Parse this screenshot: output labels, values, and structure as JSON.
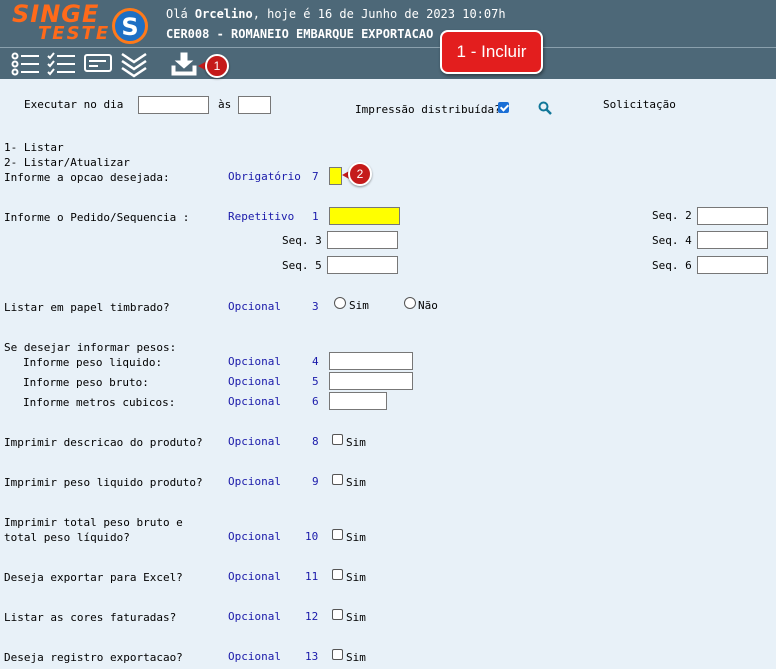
{
  "header": {
    "logo_line1": "SINGE",
    "logo_line2": "TESTE",
    "logo_mark": "S",
    "greeting_pre": "Olá ",
    "user": "Orcelino",
    "greeting_post": ", hoje é 16 de Junho de 2023 10:07h",
    "title": "CER008 - ROMANEIO EMBARQUE EXPORTACAO"
  },
  "toolbar": {
    "icons": [
      "list-icon",
      "checklist-icon",
      "card-icon",
      "chevrons-down-icon",
      "download-tray-icon"
    ]
  },
  "annotations": {
    "callout": "1 - Incluir",
    "badge1": "1",
    "badge2": "2"
  },
  "top": {
    "exec_label": "Executar no dia",
    "as_label": "às",
    "dist_label": "Impressão distribuída?",
    "dist_checked": true,
    "solic_label": "Solicitação"
  },
  "options": {
    "opt1": "1- Listar",
    "opt2": "2- Listar/Atualizar"
  },
  "fields": {
    "opcao": {
      "label": "Informe a opcao desejada:",
      "type": "Obrigatório",
      "num": "7"
    },
    "pedido": {
      "label": "Informe o Pedido/Sequencia :",
      "type": "Repetitivo",
      "num": "1"
    },
    "seq": [
      "Seq. 2",
      "Seq. 3",
      "Seq. 4",
      "Seq. 5",
      "Seq. 6"
    ],
    "timbrado": {
      "label": "Listar em papel timbrado?",
      "type": "Opcional",
      "num": "3",
      "yes": "Sim",
      "no": "Não"
    },
    "pesos_label": "Se desejar informar pesos:",
    "peso_liq": {
      "label": "Informe peso liquido:",
      "type": "Opcional",
      "num": "4"
    },
    "peso_bruto": {
      "label": "Informe peso bruto:",
      "type": "Opcional",
      "num": "5"
    },
    "metros": {
      "label": "Informe metros cubicos:",
      "type": "Opcional",
      "num": "6"
    },
    "descricao": {
      "label": "Imprimir descricao do produto?",
      "type": "Opcional",
      "num": "8",
      "yes": "Sim"
    },
    "peso_liq_prod": {
      "label": "Imprimir peso liquido produto?",
      "type": "Opcional",
      "num": "9",
      "yes": "Sim"
    },
    "total_peso_l1": "Imprimir total peso bruto e",
    "total_peso": {
      "label": "total peso líquido?",
      "type": "Opcional",
      "num": "10",
      "yes": "Sim"
    },
    "excel": {
      "label": "Deseja exportar para Excel?",
      "type": "Opcional",
      "num": "11",
      "yes": "Sim"
    },
    "cores": {
      "label": "Listar as cores faturadas?",
      "type": "Opcional",
      "num": "12",
      "yes": "Sim"
    },
    "registro": {
      "label": "Deseja registro exportacao?",
      "type": "Opcional",
      "num": "13",
      "yes": "Sim"
    }
  }
}
